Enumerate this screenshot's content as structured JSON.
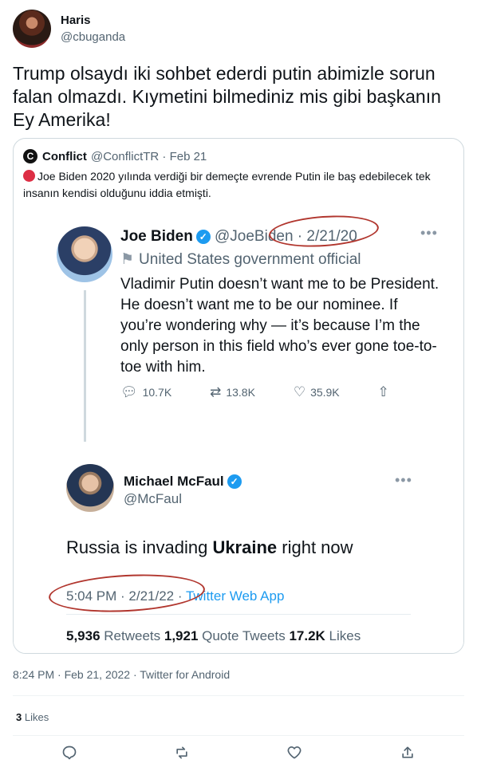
{
  "tweet": {
    "author_name": "Haris",
    "author_handle": "@cbuganda",
    "text": "Trump olsaydı iki sohbet ederdi putin abimizle sorun falan olmazdı. Kıymetini bilmediniz mis gibi başkanın Ey Amerika!",
    "timestamp": "8:24 PM · Feb 21, 2022 · Twitter for Android",
    "likes_count": "3",
    "likes_label": " Likes"
  },
  "quote": {
    "logo_letter": "C",
    "name": "Conflict",
    "handle_date": "@ConflictTR · Feb 21",
    "text": "Joe Biden 2020 yılında verdiği bir demeçte evrende Putin ile baş edebilecek tek insanın kendisi olduğunu iddia etmişti."
  },
  "embed": {
    "biden": {
      "name": "Joe Biden",
      "handle_date": "@JoeBiden · 2/21/20",
      "label": "United States government official",
      "text": "Vladimir Putin doesn’t want me to be President. He doesn’t want me to be our nominee. If you’re wondering why — it’s because I’m the only person in this field who’s ever gone toe-to-toe with him.",
      "replies": "10.7K",
      "retweets": "13.8K",
      "likes": "35.9K"
    },
    "mcfaul": {
      "name": "Michael McFaul",
      "handle": "@McFaul",
      "text_before": "Russia is invading ",
      "text_bold": "Ukraine",
      "text_after": " right now",
      "time": "5:04 PM · 2/21/22 · ",
      "app": "Twitter Web App",
      "retweets_count": "5,936",
      "retweets_label": " Retweets ",
      "quotes_count": "1,921",
      "quotes_label": " Quote Tweets ",
      "likes_count": "17.2K",
      "likes_label": " Likes"
    }
  },
  "icons": {
    "reply": "reply-icon",
    "retweet": "retweet-icon",
    "like": "heart-icon",
    "share": "share-icon",
    "verified": "verified-badge-icon",
    "more": "more-icon"
  },
  "colors": {
    "accent": "#1d9bf0",
    "annotation_ring": "#b1362e"
  }
}
